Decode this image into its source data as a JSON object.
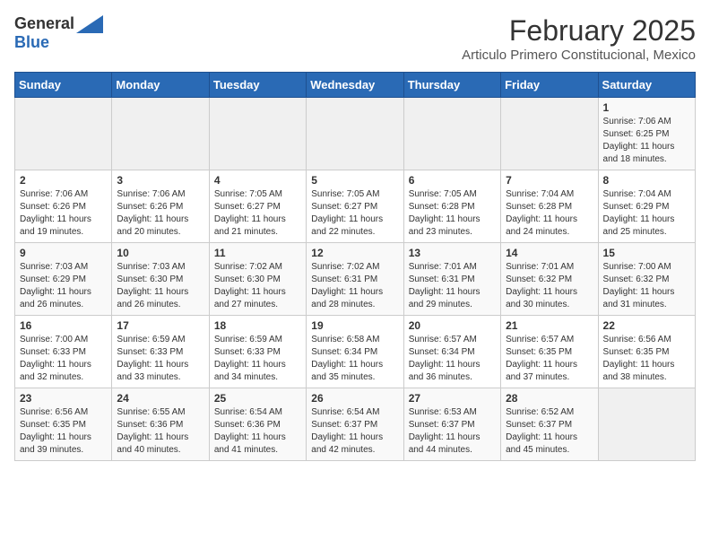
{
  "header": {
    "logo_general": "General",
    "logo_blue": "Blue",
    "title": "February 2025",
    "subtitle": "Articulo Primero Constitucional, Mexico"
  },
  "weekdays": [
    "Sunday",
    "Monday",
    "Tuesday",
    "Wednesday",
    "Thursday",
    "Friday",
    "Saturday"
  ],
  "weeks": [
    [
      {
        "day": "",
        "info": ""
      },
      {
        "day": "",
        "info": ""
      },
      {
        "day": "",
        "info": ""
      },
      {
        "day": "",
        "info": ""
      },
      {
        "day": "",
        "info": ""
      },
      {
        "day": "",
        "info": ""
      },
      {
        "day": "1",
        "info": "Sunrise: 7:06 AM\nSunset: 6:25 PM\nDaylight: 11 hours\nand 18 minutes."
      }
    ],
    [
      {
        "day": "2",
        "info": "Sunrise: 7:06 AM\nSunset: 6:26 PM\nDaylight: 11 hours\nand 19 minutes."
      },
      {
        "day": "3",
        "info": "Sunrise: 7:06 AM\nSunset: 6:26 PM\nDaylight: 11 hours\nand 20 minutes."
      },
      {
        "day": "4",
        "info": "Sunrise: 7:05 AM\nSunset: 6:27 PM\nDaylight: 11 hours\nand 21 minutes."
      },
      {
        "day": "5",
        "info": "Sunrise: 7:05 AM\nSunset: 6:27 PM\nDaylight: 11 hours\nand 22 minutes."
      },
      {
        "day": "6",
        "info": "Sunrise: 7:05 AM\nSunset: 6:28 PM\nDaylight: 11 hours\nand 23 minutes."
      },
      {
        "day": "7",
        "info": "Sunrise: 7:04 AM\nSunset: 6:28 PM\nDaylight: 11 hours\nand 24 minutes."
      },
      {
        "day": "8",
        "info": "Sunrise: 7:04 AM\nSunset: 6:29 PM\nDaylight: 11 hours\nand 25 minutes."
      }
    ],
    [
      {
        "day": "9",
        "info": "Sunrise: 7:03 AM\nSunset: 6:29 PM\nDaylight: 11 hours\nand 26 minutes."
      },
      {
        "day": "10",
        "info": "Sunrise: 7:03 AM\nSunset: 6:30 PM\nDaylight: 11 hours\nand 26 minutes."
      },
      {
        "day": "11",
        "info": "Sunrise: 7:02 AM\nSunset: 6:30 PM\nDaylight: 11 hours\nand 27 minutes."
      },
      {
        "day": "12",
        "info": "Sunrise: 7:02 AM\nSunset: 6:31 PM\nDaylight: 11 hours\nand 28 minutes."
      },
      {
        "day": "13",
        "info": "Sunrise: 7:01 AM\nSunset: 6:31 PM\nDaylight: 11 hours\nand 29 minutes."
      },
      {
        "day": "14",
        "info": "Sunrise: 7:01 AM\nSunset: 6:32 PM\nDaylight: 11 hours\nand 30 minutes."
      },
      {
        "day": "15",
        "info": "Sunrise: 7:00 AM\nSunset: 6:32 PM\nDaylight: 11 hours\nand 31 minutes."
      }
    ],
    [
      {
        "day": "16",
        "info": "Sunrise: 7:00 AM\nSunset: 6:33 PM\nDaylight: 11 hours\nand 32 minutes."
      },
      {
        "day": "17",
        "info": "Sunrise: 6:59 AM\nSunset: 6:33 PM\nDaylight: 11 hours\nand 33 minutes."
      },
      {
        "day": "18",
        "info": "Sunrise: 6:59 AM\nSunset: 6:33 PM\nDaylight: 11 hours\nand 34 minutes."
      },
      {
        "day": "19",
        "info": "Sunrise: 6:58 AM\nSunset: 6:34 PM\nDaylight: 11 hours\nand 35 minutes."
      },
      {
        "day": "20",
        "info": "Sunrise: 6:57 AM\nSunset: 6:34 PM\nDaylight: 11 hours\nand 36 minutes."
      },
      {
        "day": "21",
        "info": "Sunrise: 6:57 AM\nSunset: 6:35 PM\nDaylight: 11 hours\nand 37 minutes."
      },
      {
        "day": "22",
        "info": "Sunrise: 6:56 AM\nSunset: 6:35 PM\nDaylight: 11 hours\nand 38 minutes."
      }
    ],
    [
      {
        "day": "23",
        "info": "Sunrise: 6:56 AM\nSunset: 6:35 PM\nDaylight: 11 hours\nand 39 minutes."
      },
      {
        "day": "24",
        "info": "Sunrise: 6:55 AM\nSunset: 6:36 PM\nDaylight: 11 hours\nand 40 minutes."
      },
      {
        "day": "25",
        "info": "Sunrise: 6:54 AM\nSunset: 6:36 PM\nDaylight: 11 hours\nand 41 minutes."
      },
      {
        "day": "26",
        "info": "Sunrise: 6:54 AM\nSunset: 6:37 PM\nDaylight: 11 hours\nand 42 minutes."
      },
      {
        "day": "27",
        "info": "Sunrise: 6:53 AM\nSunset: 6:37 PM\nDaylight: 11 hours\nand 44 minutes."
      },
      {
        "day": "28",
        "info": "Sunrise: 6:52 AM\nSunset: 6:37 PM\nDaylight: 11 hours\nand 45 minutes."
      },
      {
        "day": "",
        "info": ""
      }
    ]
  ]
}
